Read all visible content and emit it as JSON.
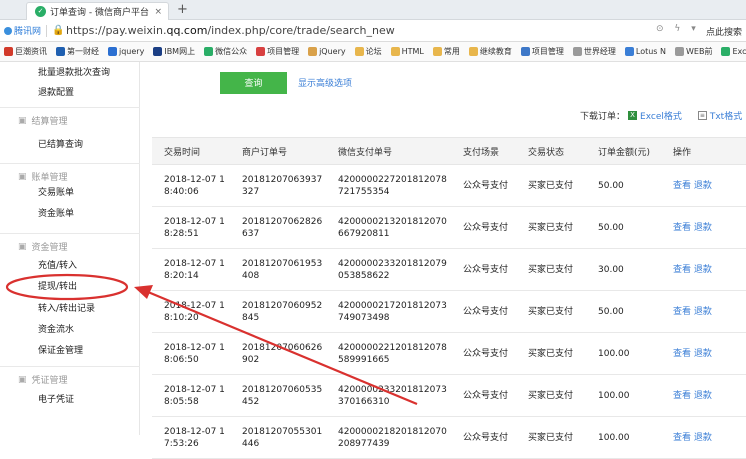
{
  "browser": {
    "tab_title": "订单查询 - 微信商户平台",
    "tab_close": "×",
    "new_tab": "+",
    "origin": "腾讯网",
    "url_prefix": "https://pay.weixin.",
    "url_domain": "qq.com",
    "url_path": "/index.php/core/trade/search_new",
    "search_label": "点此搜索"
  },
  "bookmarks": [
    {
      "label": "巨潮资讯",
      "color": "#d23a2a"
    },
    {
      "label": "第一财经",
      "color": "#1f5fb0"
    },
    {
      "label": "jquery",
      "color": "#2b6fd1"
    },
    {
      "label": "IBM网上",
      "color": "#1c3f85"
    },
    {
      "label": "微信公众",
      "color": "#2aae67"
    },
    {
      "label": "项目管理",
      "color": "#d84040"
    },
    {
      "label": "jQuery",
      "color": "#d9a14a"
    },
    {
      "label": "论坛",
      "color": "#e8b64c"
    },
    {
      "label": "HTML",
      "color": "#e8b64c"
    },
    {
      "label": "常用",
      "color": "#e8b64c"
    },
    {
      "label": "继续教育",
      "color": "#e8b64c"
    },
    {
      "label": "项目管理",
      "color": "#3e78c8"
    },
    {
      "label": "世界经理",
      "color": "#9a9a9a"
    },
    {
      "label": "Lotus N",
      "color": "#3a7ed6"
    },
    {
      "label": "WEB前",
      "color": "#9a9a9a"
    },
    {
      "label": "Excel教",
      "color": "#2aae67"
    }
  ],
  "sidebar": {
    "top_items": [
      "批量退款批次查询",
      "退款配置"
    ],
    "groups": [
      {
        "title": "结算管理",
        "items": [
          "已结算查询"
        ]
      },
      {
        "title": "账单管理",
        "items": [
          "交易账单",
          "资金账单"
        ]
      },
      {
        "title": "资金管理",
        "items": [
          "充值/转入",
          "提现/转出",
          "转入/转出记录",
          "资金流水",
          "保证金管理"
        ]
      },
      {
        "title": "凭证管理",
        "items": [
          "电子凭证"
        ]
      }
    ]
  },
  "main": {
    "query_button": "查询",
    "advanced_link": "显示高级选项",
    "download_label": "下载订单：",
    "excel_label": "Excel格式",
    "txt_label": "Txt格式",
    "columns": [
      "交易时间",
      "商户订单号",
      "微信支付单号",
      "支付场景",
      "交易状态",
      "订单金额(元)",
      "操作"
    ],
    "rows": [
      [
        "2018-12-07 18:40:06",
        "20181207063937327",
        "4200000227201812078721755354",
        "公众号支付",
        "买家已支付",
        "50.00"
      ],
      [
        "2018-12-07 18:28:51",
        "20181207062826637",
        "4200000213201812070667920811",
        "公众号支付",
        "买家已支付",
        "50.00"
      ],
      [
        "2018-12-07 18:20:14",
        "20181207061953408",
        "4200000233201812079053858622",
        "公众号支付",
        "买家已支付",
        "30.00"
      ],
      [
        "2018-12-07 18:10:20",
        "20181207060952845",
        "4200000217201812073749073498",
        "公众号支付",
        "买家已支付",
        "50.00"
      ],
      [
        "2018-12-07 18:06:50",
        "20181207060626902",
        "4200000221201812078589991665",
        "公众号支付",
        "买家已支付",
        "100.00"
      ],
      [
        "2018-12-07 18:05:58",
        "20181207060535452",
        "4200000233201812073370166310",
        "公众号支付",
        "买家已支付",
        "100.00"
      ],
      [
        "2018-12-07 17:53:26",
        "20181207055301446",
        "4200000218201812070208977439",
        "公众号支付",
        "买家已支付",
        "100.00"
      ]
    ],
    "action_view": "查看",
    "action_refund": "退款"
  },
  "colors": {
    "accent_green": "#44b549",
    "link_blue": "#3a7ed6",
    "annotation_red": "#d9312f"
  }
}
